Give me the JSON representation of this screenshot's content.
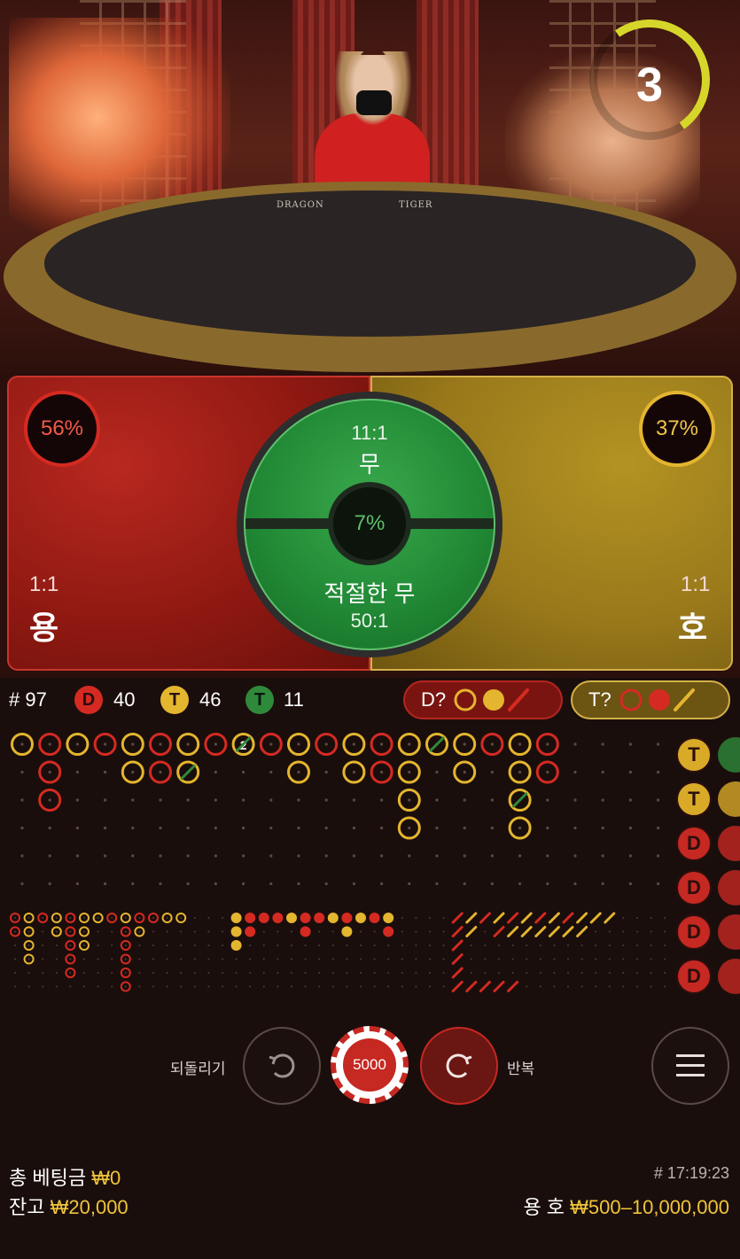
{
  "timer": {
    "value": "3",
    "color": "#d6d62a"
  },
  "table": {
    "dragon_label": "DRAGON",
    "tiger_label": "TIGER"
  },
  "bets": {
    "dragon": {
      "percent": "56%",
      "odds": "1:1",
      "name": "용",
      "color": "#8f1912"
    },
    "tiger": {
      "percent": "37%",
      "odds": "1:1",
      "name": "호",
      "color": "#98781a"
    },
    "tie": {
      "odds": "11:1",
      "name": "무",
      "percent": "7%"
    },
    "suited_tie": {
      "name": "적절한 무",
      "odds": "50:1"
    }
  },
  "stats": {
    "round_label": "# 97",
    "dragon": {
      "badge": "D",
      "count": "40"
    },
    "tiger": {
      "badge": "T",
      "count": "46"
    },
    "tie": {
      "badge": "T",
      "count": "11"
    },
    "dragon_predict": "D?",
    "tiger_predict": "T?"
  },
  "recent": [
    "T",
    "T",
    "D",
    "D",
    "D",
    "D"
  ],
  "controls": {
    "undo_label": "되돌리기",
    "chip_value": "5000",
    "repeat_label": "반복",
    "menu_icon": "hamburger-icon"
  },
  "footer": {
    "total_bet_label": "총 베팅금",
    "total_bet_value": "₩0",
    "balance_label": "잔고",
    "balance_value": "₩20,000",
    "time": "# 17:19:23",
    "limit_label": "용 호",
    "limit_value": "₩500–10,000,000"
  },
  "colors": {
    "dragon": "#d52a22",
    "tiger": "#e4b52f",
    "tie": "#2e8a3a"
  }
}
